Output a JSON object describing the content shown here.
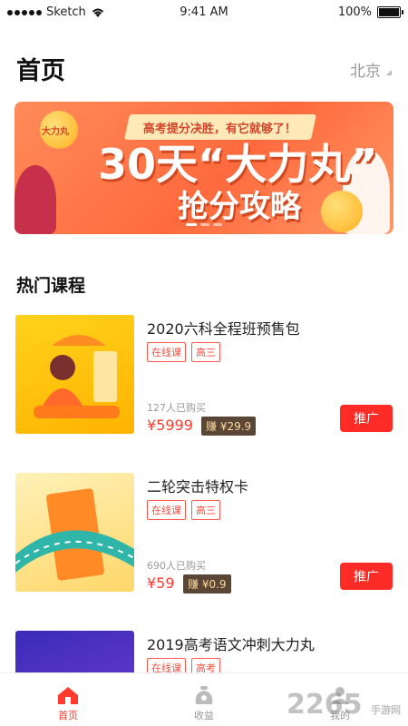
{
  "status": {
    "carrier": "Sketch",
    "time": "9:41 AM",
    "battery": "100%"
  },
  "header": {
    "title": "首页",
    "city": "北京"
  },
  "banner": {
    "ribbon": "高考提分决胜，有它就够了！",
    "headline": "30天“大力丸”",
    "subline": "抢分攻略",
    "ball_text": "大力丸"
  },
  "section": {
    "title": "热门课程"
  },
  "courses": [
    {
      "name": "2020六科全程班预售包",
      "tags": [
        "在线课",
        "高三"
      ],
      "buyers": "127人已购买",
      "price": "¥5999",
      "earn": "赚 ¥29.9",
      "button": "推广"
    },
    {
      "name": "二轮突击特权卡",
      "tags": [
        "在线课",
        "高三"
      ],
      "buyers": "690人已购买",
      "price": "¥59",
      "earn": "赚 ¥0.9",
      "button": "推广"
    },
    {
      "name": "2019高考语文冲刺大力丸",
      "tags": [
        "在线课",
        "高考"
      ]
    }
  ],
  "tabbar": [
    {
      "label": "首页",
      "active": true
    },
    {
      "label": "收益"
    },
    {
      "label": "我的"
    }
  ],
  "watermark": {
    "brand": "2265",
    "site": "手游网"
  },
  "colors": {
    "accent": "#ff3b30",
    "banner": "#ff6a3d",
    "earn_bg": "#5a4636"
  }
}
